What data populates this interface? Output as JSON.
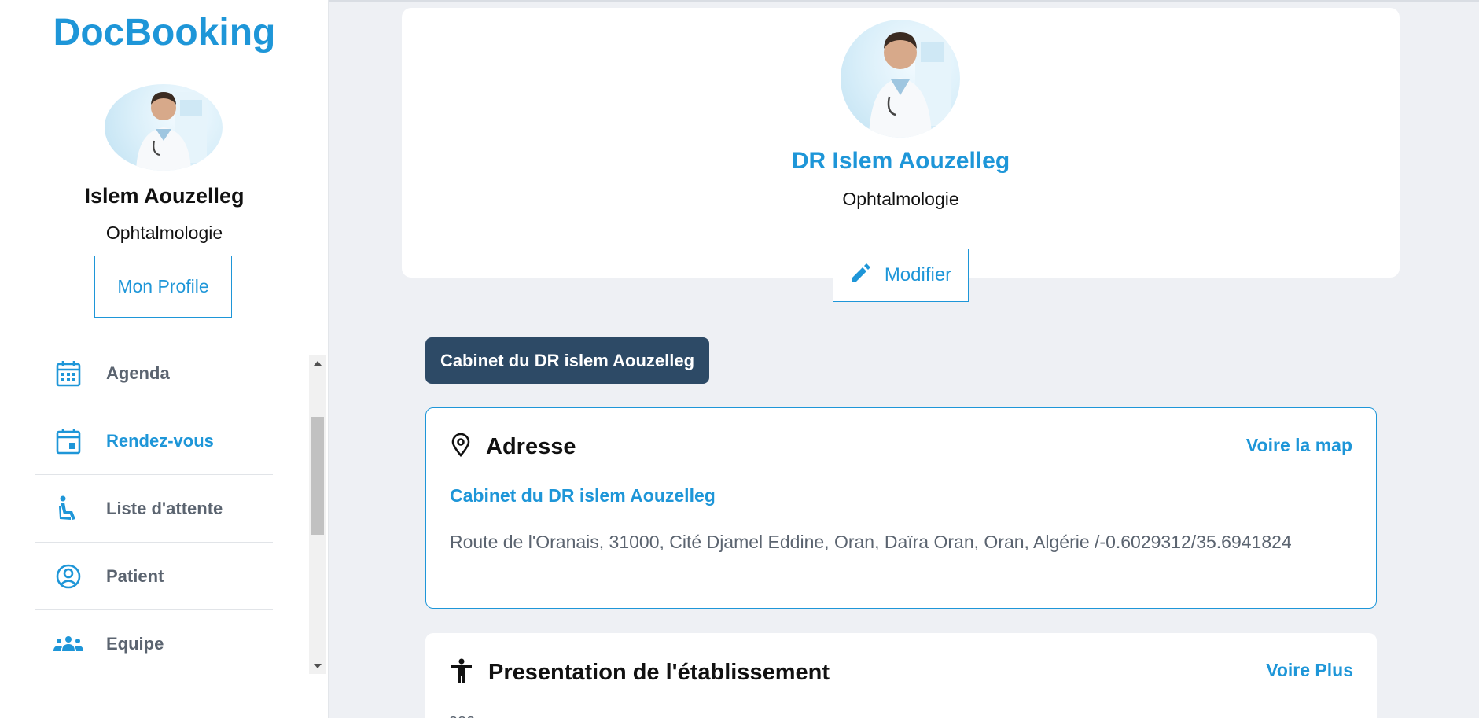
{
  "sidebar": {
    "brand": "DocBooking",
    "doctor_name": "Islem Aouzelleg",
    "specialty": "Ophtalmologie",
    "profile_button": "Mon Profile",
    "nav": [
      {
        "label": "Agenda",
        "icon": "calendar-grid-icon",
        "active": false
      },
      {
        "label": "Rendez-vous",
        "icon": "calendar-event-icon",
        "active": true
      },
      {
        "label": "Liste d'attente",
        "icon": "wheelchair-icon",
        "active": false
      },
      {
        "label": "Patient",
        "icon": "user-circle-icon",
        "active": false
      },
      {
        "label": "Equipe",
        "icon": "group-icon",
        "active": false
      }
    ]
  },
  "profile": {
    "name": "DR Islem Aouzelleg",
    "specialty": "Ophtalmologie",
    "modify_button": "Modifier"
  },
  "cabinet_label": "Cabinet du DR islem Aouzelleg",
  "address_card": {
    "title": "Adresse",
    "map_link": "Voire la map",
    "cabinet_name": "Cabinet du DR islem Aouzelleg",
    "address": "Route de l'Oranais, 31000, Cité Djamel Eddine, Oran, Daïra Oran, Oran, Algérie /-0.6029312/35.6941824"
  },
  "presentation_card": {
    "title": "Presentation de l'établissement",
    "more_link": "Voire Plus",
    "text": "aaa"
  },
  "colors": {
    "accent": "#1e96d8",
    "dark_pill": "#2d4a66",
    "background": "#eef0f4",
    "nav_text": "#5b6470"
  }
}
